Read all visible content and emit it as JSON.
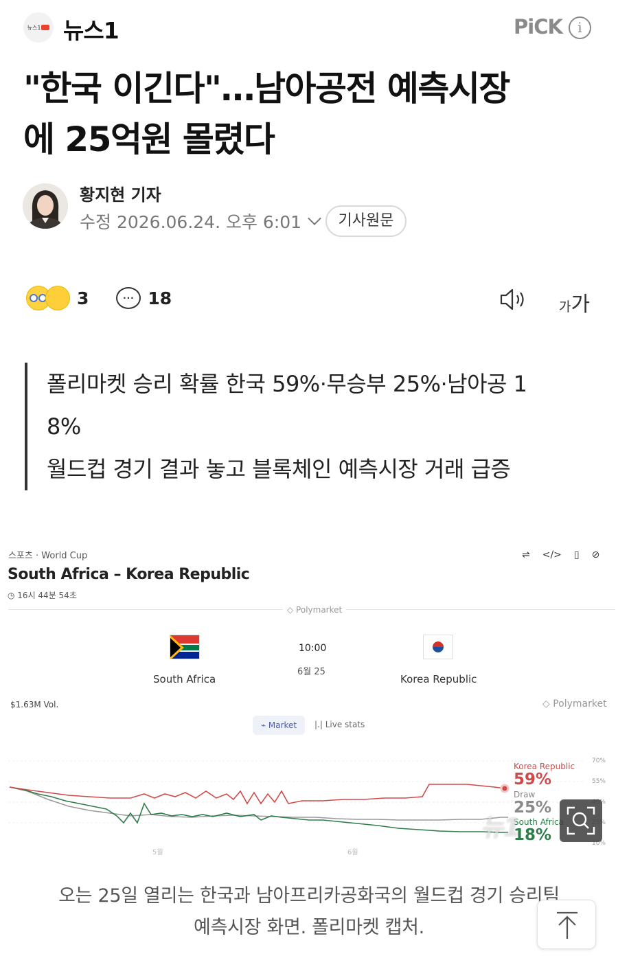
{
  "header": {
    "logo_text": "뉴스1",
    "brand": "뉴스1",
    "pick_label": "PiCK",
    "info_icon": "info-icon"
  },
  "article": {
    "headline_line1": "\"한국 이긴다\"…남아공전 예측시장",
    "headline_line2": "에 25억원 몰렸다",
    "reporter": "황지현 기자",
    "modified": "수정 2026.06.24. 오후 6:01",
    "original_button": "기사원문",
    "reactions_count": "3",
    "comments_count": "18",
    "font_small": "가",
    "font_big": "가"
  },
  "summary": {
    "line1": "폴리마켓 승리 확률 한국 59%·무승부 25%·남아공 1",
    "line2": "8%",
    "line3": "월드컵 경기 결과 놓고 블록체인 예측시장 거래 급증"
  },
  "figure": {
    "category": "스포츠 · World Cup",
    "title": "South Africa – Korea Republic",
    "countdown": "16시 44분 54초",
    "source_top": "Polymarket",
    "match_time": "10:00",
    "match_date": "6월 25",
    "team_home": "South Africa",
    "team_away": "Korea Republic",
    "volume": "$1.63M Vol.",
    "source_right": "Polymarket",
    "tab_market": "Market",
    "tab_live": "Live stats",
    "watermark": "뉴1"
  },
  "chart_data": {
    "type": "line",
    "x_labels": [
      "5월",
      "6월"
    ],
    "y_ticks": [
      "70%",
      "55%",
      "40%",
      "25%",
      "10%"
    ],
    "series": [
      {
        "name": "Korea Republic",
        "current": "59%",
        "color": "#d04a4a"
      },
      {
        "name": "Draw",
        "current": "25%",
        "color": "#8a8a8a"
      },
      {
        "name": "South Africa",
        "current": "18%",
        "color": "#2e7d4a"
      }
    ]
  },
  "caption": {
    "line1": "오는 25일 열리는 한국과 남아프리카공화국의 월드컵 경기 승리팀",
    "line2": "예측시장 화면. 폴리마켓 캡처."
  }
}
